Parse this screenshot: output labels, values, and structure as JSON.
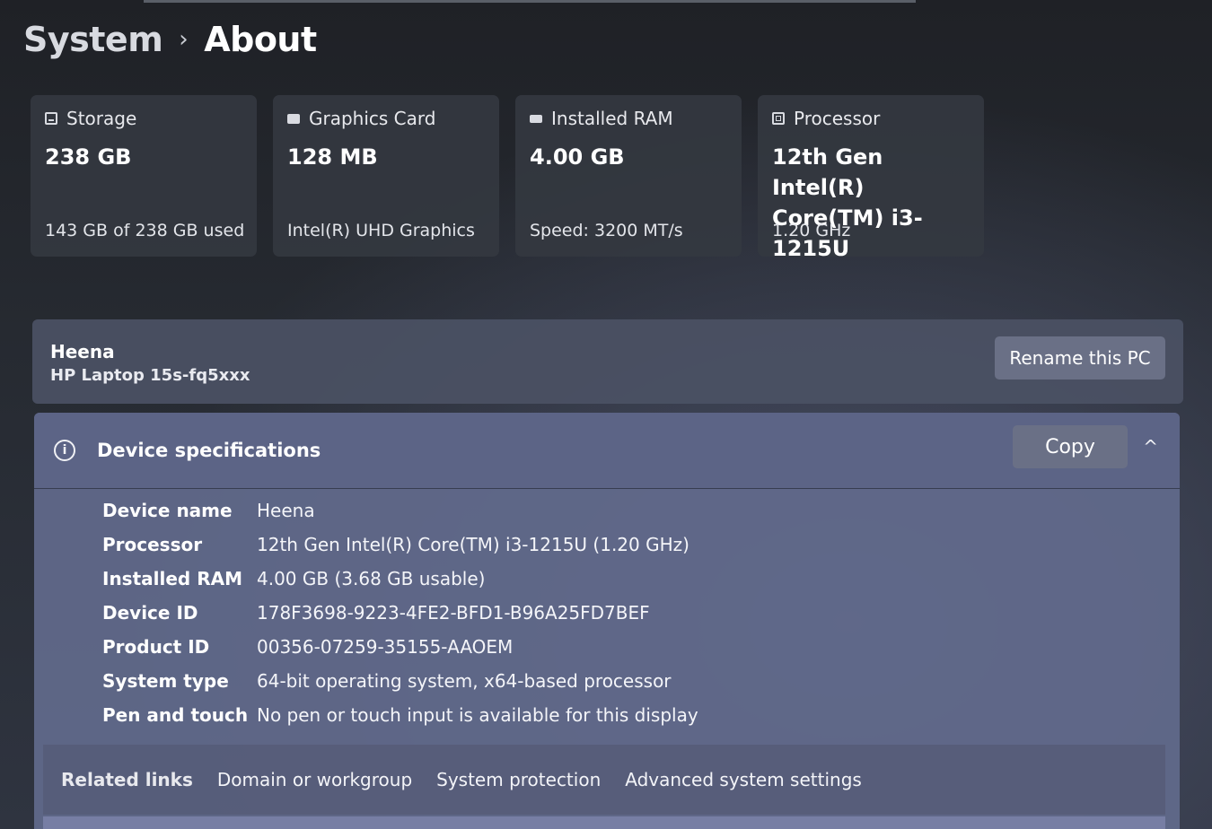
{
  "breadcrumb": {
    "parent": "System",
    "separator": "›",
    "current": "About"
  },
  "cards": [
    {
      "icon": "storage-icon",
      "title": "Storage",
      "value": "238 GB",
      "sub": "143 GB of 238 GB used"
    },
    {
      "icon": "graphics-card-icon",
      "title": "Graphics Card",
      "value": "128 MB",
      "sub": "Intel(R) UHD Graphics"
    },
    {
      "icon": "ram-icon",
      "title": "Installed RAM",
      "value": "4.00 GB",
      "sub": "Speed: 3200 MT/s"
    },
    {
      "icon": "processor-icon",
      "title": "Processor",
      "value_line1": "12th Gen Intel(R)",
      "value_line2": "Core(TM) i3-1215U",
      "sub": "1.20 GHz"
    }
  ],
  "pc": {
    "name": "Heena",
    "model": "HP Laptop 15s-fq5xxx",
    "rename_label": "Rename this PC"
  },
  "specs": {
    "title": "Device specifications",
    "copy_label": "Copy",
    "rows": [
      {
        "label": "Device name",
        "value": "Heena"
      },
      {
        "label": "Processor",
        "value": "12th Gen Intel(R) Core(TM) i3-1215U (1.20 GHz)"
      },
      {
        "label": "Installed RAM",
        "value": "4.00 GB (3.68 GB usable)"
      },
      {
        "label": "Device ID",
        "value": "178F3698-9223-4FE2-BFD1-B96A25FD7BEF"
      },
      {
        "label": "Product ID",
        "value": "00356-07259-35155-AAOEM"
      },
      {
        "label": "System type",
        "value": "64-bit operating system, x64-based processor"
      },
      {
        "label": "Pen and touch",
        "value": "No pen or touch input is available for this display"
      }
    ]
  },
  "related": {
    "label": "Related links",
    "links": [
      "Domain or workgroup",
      "System protection",
      "Advanced system settings"
    ]
  },
  "colors": {
    "background": "#23262c",
    "card": "#343840",
    "specs_panel": "#626a8c",
    "button": "#6a7086"
  }
}
